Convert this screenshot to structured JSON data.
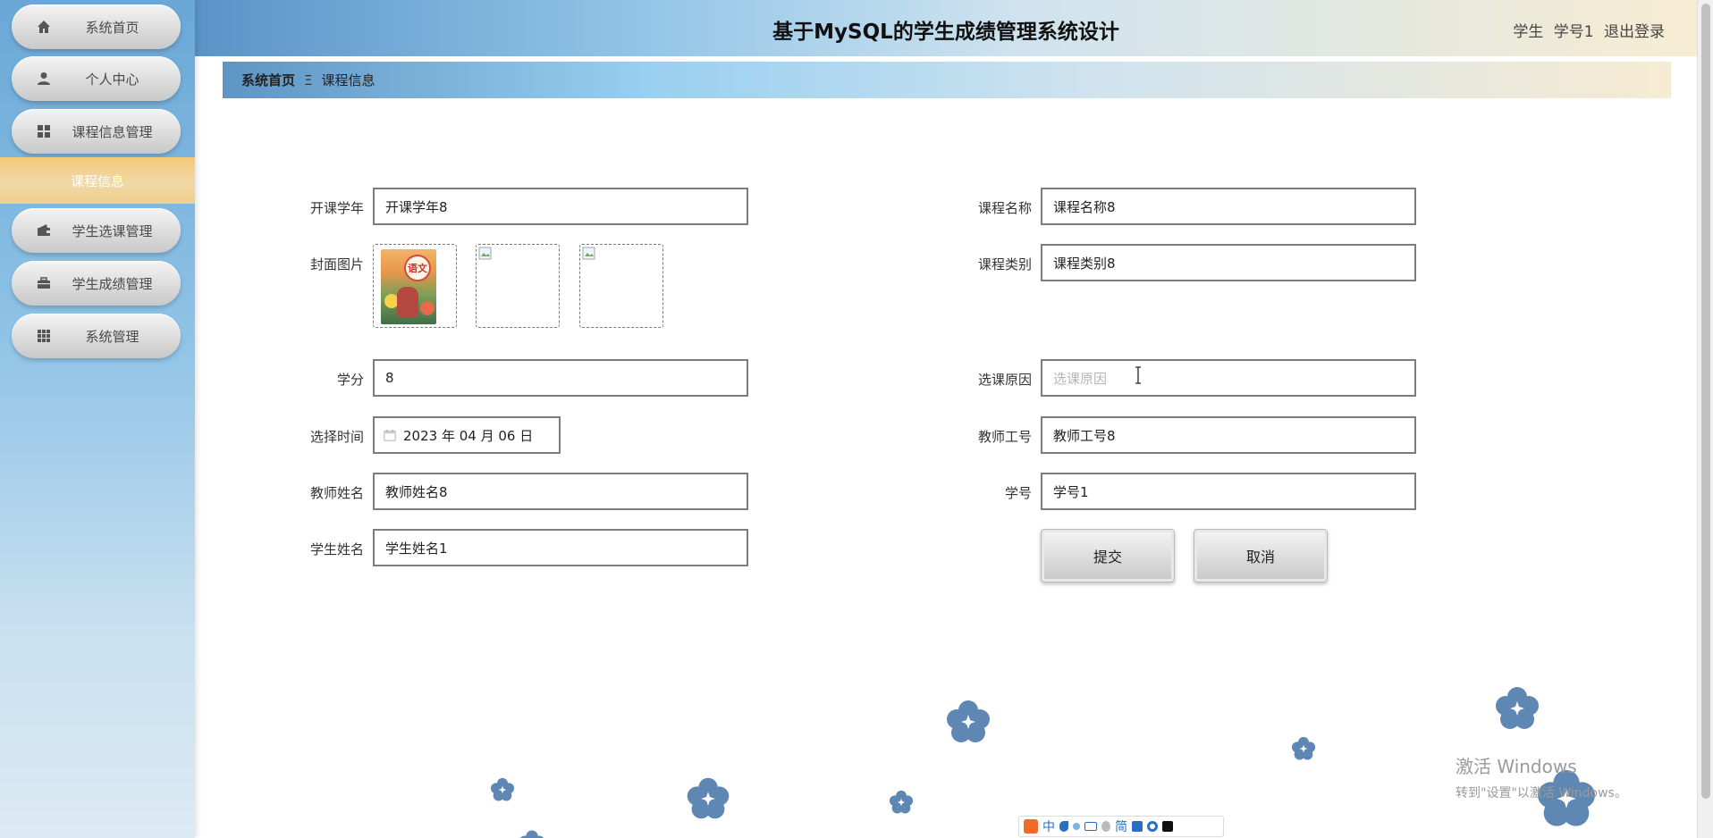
{
  "app": {
    "title": "基于MySQL的学生成绩管理系统设计",
    "user_role": "学生",
    "user_id": "学号1",
    "logout": "退出登录"
  },
  "sidebar": {
    "items": [
      {
        "label": "系统首页",
        "icon": "home-icon"
      },
      {
        "label": "个人中心",
        "icon": "user-icon"
      },
      {
        "label": "课程信息管理",
        "icon": "grid-icon"
      },
      {
        "label": "学生选课管理",
        "icon": "wallet-icon"
      },
      {
        "label": "学生成绩管理",
        "icon": "briefcase-icon"
      },
      {
        "label": "系统管理",
        "icon": "apps-icon"
      }
    ],
    "active_sub": "课程信息"
  },
  "breadcrumb": {
    "home": "系统首页",
    "separator": "Ξ",
    "current": "课程信息"
  },
  "form": {
    "year": {
      "label": "开课学年",
      "value": "开课学年8"
    },
    "course_name": {
      "label": "课程名称",
      "value": "课程名称8"
    },
    "cover": {
      "label": "封面图片",
      "book_badge": "语文"
    },
    "course_type": {
      "label": "课程类别",
      "value": "课程类别8"
    },
    "credit": {
      "label": "学分",
      "value": "8"
    },
    "reason": {
      "label": "选课原因",
      "placeholder": "选课原因"
    },
    "select_time": {
      "label": "选择时间",
      "value": "2023 年 04 月 06 日"
    },
    "teacher_id": {
      "label": "教师工号",
      "value": "教师工号8"
    },
    "teacher_name": {
      "label": "教师姓名",
      "value": "教师姓名8"
    },
    "student_id": {
      "label": "学号",
      "value": "学号1"
    },
    "student_name": {
      "label": "学生姓名",
      "value": "学生姓名1"
    },
    "submit": "提交",
    "cancel": "取消"
  },
  "ime": {
    "chinese": "中",
    "simplified": "简"
  },
  "watermark": {
    "line1": "激活 Windows",
    "line2": "转到\"设置\"以激活 Windows。"
  },
  "colors": {
    "sidebar_top": "#6aa7d6",
    "active_sub": "#f3c877",
    "flower": "#5f87b3"
  }
}
